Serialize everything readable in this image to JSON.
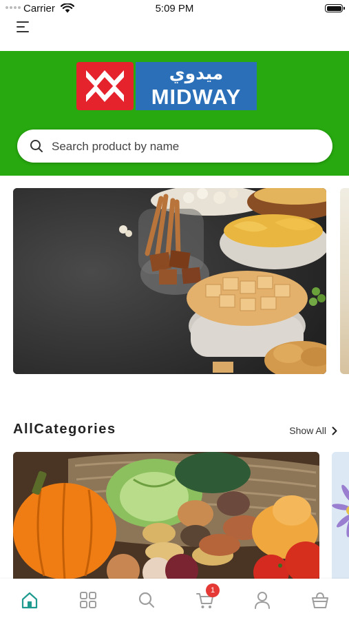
{
  "status_bar": {
    "carrier": "Carrier",
    "time": "5:09 PM"
  },
  "header": {
    "background_color": "#27a90f",
    "logo": {
      "arabic_text": "ميدوي",
      "latin_text": "MIDWAY"
    },
    "search": {
      "placeholder": "Search product by name",
      "value": ""
    }
  },
  "banner": {
    "image": "snacks-banner"
  },
  "categories_section": {
    "title": "AllCategories",
    "show_all_label": "Show All",
    "items": [
      {
        "image": "vegetables-basket"
      },
      {
        "image": "flowers"
      }
    ]
  },
  "bottom_nav": {
    "active_color": "#1f9a8f",
    "inactive_color": "#9e9e9e",
    "items": [
      {
        "icon": "home-icon",
        "active": true
      },
      {
        "icon": "grid-icon",
        "active": false
      },
      {
        "icon": "search-icon",
        "active": false
      },
      {
        "icon": "cart-icon",
        "active": false,
        "badge": "1"
      },
      {
        "icon": "user-icon",
        "active": false
      },
      {
        "icon": "bag-icon",
        "active": false
      }
    ]
  }
}
